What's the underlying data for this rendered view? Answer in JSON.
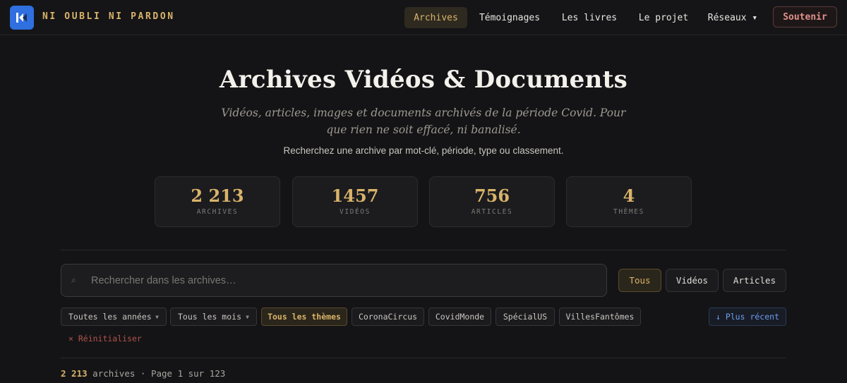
{
  "nav": {
    "brand": "NI OUBLI NI PARDON",
    "links": [
      {
        "label": "Archives",
        "active": true
      },
      {
        "label": "Témoignages"
      },
      {
        "label": "Les livres"
      },
      {
        "label": "Le projet"
      },
      {
        "label": "Réseaux ▾"
      }
    ],
    "support_label": "Soutenir"
  },
  "header": {
    "title": "Archives Vidéos & Documents",
    "subtitle": "Vidéos, articles, images et documents archivés de la période Covid. Pour que rien ne soit effacé, ni banalisé.",
    "hint": "Recherchez une archive par mot-clé, période, type ou classement."
  },
  "stats": [
    {
      "value": "2 213",
      "label": "ARCHIVES"
    },
    {
      "value": "1457",
      "label": "VIDÉOS"
    },
    {
      "value": "756",
      "label": "ARTICLES"
    },
    {
      "value": "4",
      "label": "THÈMES"
    }
  ],
  "search": {
    "placeholder": "Rechercher dans les archives…",
    "value": ""
  },
  "type_filters": [
    {
      "label": "Tous",
      "active": true
    },
    {
      "label": "Vidéos"
    },
    {
      "label": "Articles"
    }
  ],
  "filters": {
    "year_select": "Toutes les années",
    "month_select": "Tous les mois",
    "themes": [
      {
        "label": "Tous les thèmes",
        "active": true
      },
      {
        "label": "CoronaCircus"
      },
      {
        "label": "CovidMonde"
      },
      {
        "label": "SpécialUS"
      },
      {
        "label": "VillesFantômes"
      }
    ],
    "sort_label": "↓ Plus récent",
    "reset_label": "× Réinitialiser"
  },
  "results": {
    "count": "2 213",
    "count_suffix": "archives · Page 1 sur 123"
  },
  "colors": {
    "accent": "#d9b36a",
    "logo_bg": "#2f6fe0",
    "support": "#e1908a",
    "sort": "#6e9ef0",
    "reset": "#b3534c"
  }
}
